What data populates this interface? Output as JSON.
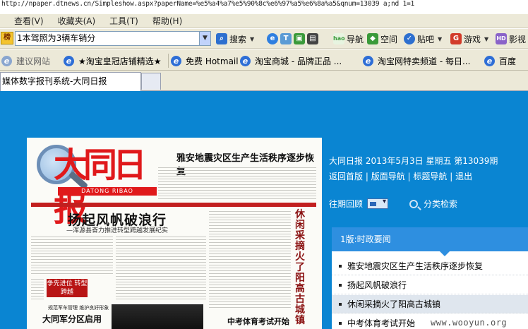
{
  "browser": {
    "address": "http://npaper.dtnews.cn/Simpleshow.aspx?paperName=%e5%a4%a7%e5%90%8c%e6%97%a5%e6%8a%a5&qnum=13039 a;nd 1=1",
    "menu": [
      "查看(V)",
      "收藏夹(A)",
      "工具(T)",
      "帮助(H)"
    ],
    "search_toolbar": {
      "query": "1本驾照为3辆车销分",
      "search_label": "搜索",
      "items": [
        "导航",
        "空间",
        "贴吧",
        "游戏",
        "影视"
      ]
    },
    "favorites": [
      "建议网站",
      "★淘宝皇冠店铺精选★",
      "免费 Hotmail",
      "淘宝商城 - 品牌正品 ...",
      "淘宝网特卖频道 - 每日...",
      "百度"
    ],
    "tab_title": "媒体数字报刊系统-大同日报",
    "colors": {
      "page_bg": "#0a85d2",
      "list_header": "#2e8fe0",
      "masthead_red": "#e0191b"
    }
  },
  "paper": {
    "masthead": "大同日报",
    "masthead_sub": "DATONG RIBAO",
    "top_headline": "雅安地震灾区生产生活秩序逐步恢复",
    "main_headline": "扬起风帆破浪行",
    "main_subhead": "—浑源县奋力推进转型跨越发展纪实",
    "vertical_headline": "休闲采摘火了阳高古城镇",
    "red_tag": "争先进位 转型跨越",
    "bottom_small": "规范军车管理  维护良好形象",
    "bottom_headline": "大同军分区启用",
    "bottom_right_headline": "中考体育考试开始"
  },
  "sidebar": {
    "date_line": "大同日报  2013年5月3日  星期五  第13039期",
    "nav_links": [
      "返回首版",
      "版面导航",
      "标题导航",
      "退出"
    ],
    "past_issues_label": "往期回顾",
    "category_search_label": "分类检索",
    "section_title": "1版:时政要闻",
    "items": [
      "雅安地震灾区生产生活秩序逐步恢复",
      "扬起风帆破浪行",
      "休闲采摘火了阳高古城镇",
      "中考体育考试开始"
    ],
    "highlighted_index": 2
  },
  "watermark": "www.wooyun.org"
}
